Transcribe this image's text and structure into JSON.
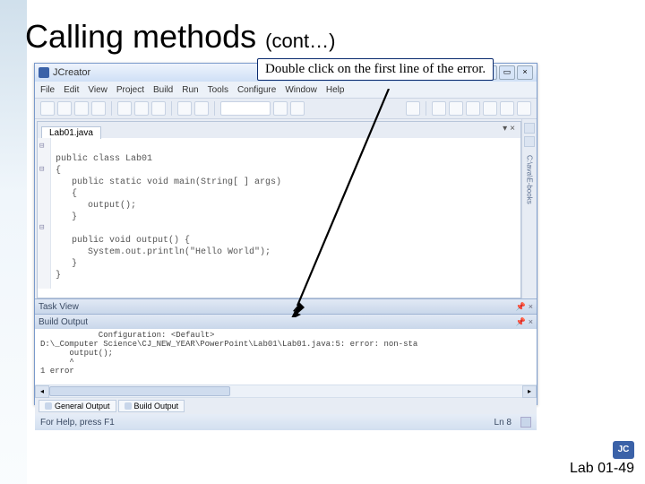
{
  "slide_title_main": "Calling methods",
  "slide_title_cont": "(cont…)",
  "callout_text": "Double click on the first line of the error.",
  "app": {
    "title": "JCreator",
    "menus": [
      "File",
      "Edit",
      "View",
      "Project",
      "Build",
      "Run",
      "Tools",
      "Configure",
      "Window",
      "Help"
    ],
    "tab_label": "Lab01.java",
    "side_label": "C:\\ava\\E-books",
    "code_lines": [
      "public class Lab01",
      "{",
      "   public static void main(String[ ] args)",
      "   {",
      "      output();",
      "   }",
      "",
      "   public void output() {",
      "      System.out.println(\"Hello World\");",
      "   }",
      "}"
    ],
    "task_view_label": "Task View",
    "build_output_label": "Build Output",
    "build_body": "            Configuration: <Default>\nD:\\_Computer Science\\CJ_NEW_YEAR\\PowerPoint\\Lab01\\Lab01.java:5: error: non-sta\n      output();\n      ^\n1 error",
    "bottom_tabs": [
      "General Output",
      "Build Output"
    ],
    "status_left": "For Help, press F1",
    "status_right": "Ln 8"
  },
  "footer_text": "Lab 01-49"
}
